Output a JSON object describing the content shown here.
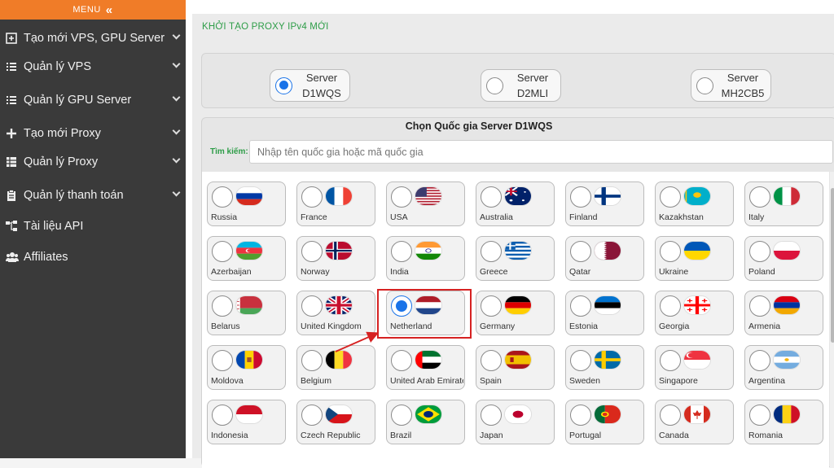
{
  "sidebar": {
    "menu_label": "MENU",
    "items": [
      {
        "label": "Tạo mới VPS, GPU Server",
        "icon": "plus-square-icon",
        "has_arrow": true
      },
      {
        "label": "Quản lý VPS",
        "icon": "list-icon",
        "has_arrow": true
      },
      {
        "label": "Quản lý GPU Server",
        "icon": "list-icon",
        "has_arrow": true
      },
      {
        "label": "Tạo mới Proxy",
        "icon": "plus-icon",
        "has_arrow": true
      },
      {
        "label": "Quản lý Proxy",
        "icon": "table-icon",
        "has_arrow": true
      },
      {
        "label": "Quản lý thanh toán",
        "icon": "clipboard-icon",
        "has_arrow": true
      },
      {
        "label": "Tài liệu API",
        "icon": "sitemap-icon",
        "has_arrow": false
      },
      {
        "label": "Affiliates",
        "icon": "users-icon",
        "has_arrow": false
      }
    ]
  },
  "page": {
    "title": "KHỞI TẠO PROXY IPv4 MỚI"
  },
  "servers": {
    "selected": "D1WQS",
    "options": [
      {
        "line1": "Server",
        "line2": "D1WQS",
        "selected": true
      },
      {
        "line1": "Server",
        "line2": "D2MLI",
        "selected": false
      },
      {
        "line1": "Server",
        "line2": "MH2CB5",
        "selected": false
      }
    ]
  },
  "country_panel": {
    "title": "Chọn Quốc gia Server D1WQS",
    "search_label": "Tìm kiếm:",
    "search_placeholder": "Nhập tên quốc gia hoặc mã quốc gia"
  },
  "countries": [
    {
      "name": "Russia",
      "flag": "russia-flag-icon",
      "selected": false
    },
    {
      "name": "France",
      "flag": "france-flag-icon",
      "selected": false
    },
    {
      "name": "USA",
      "flag": "usa-flag-icon",
      "selected": false
    },
    {
      "name": "Australia",
      "flag": "australia-flag-icon",
      "selected": false
    },
    {
      "name": "Finland",
      "flag": "finland-flag-icon",
      "selected": false
    },
    {
      "name": "Kazakhstan",
      "flag": "kazakhstan-flag-icon",
      "selected": false
    },
    {
      "name": "Italy",
      "flag": "italy-flag-icon",
      "selected": false
    },
    {
      "name": "Azerbaijan",
      "flag": "azerbaijan-flag-icon",
      "selected": false
    },
    {
      "name": "Norway",
      "flag": "norway-flag-icon",
      "selected": false
    },
    {
      "name": "India",
      "flag": "india-flag-icon",
      "selected": false
    },
    {
      "name": "Greece",
      "flag": "greece-flag-icon",
      "selected": false
    },
    {
      "name": "Qatar",
      "flag": "qatar-flag-icon",
      "selected": false
    },
    {
      "name": "Ukraine",
      "flag": "ukraine-flag-icon",
      "selected": false
    },
    {
      "name": "Poland",
      "flag": "poland-flag-icon",
      "selected": false
    },
    {
      "name": "Belarus",
      "flag": "belarus-flag-icon",
      "selected": false
    },
    {
      "name": "United Kingdom",
      "flag": "uk-flag-icon",
      "selected": false
    },
    {
      "name": "Netherland",
      "flag": "netherlands-flag-icon",
      "selected": true
    },
    {
      "name": "Germany",
      "flag": "germany-flag-icon",
      "selected": false
    },
    {
      "name": "Estonia",
      "flag": "estonia-flag-icon",
      "selected": false
    },
    {
      "name": "Georgia",
      "flag": "georgia-flag-icon",
      "selected": false
    },
    {
      "name": "Armenia",
      "flag": "armenia-flag-icon",
      "selected": false
    },
    {
      "name": "Moldova",
      "flag": "moldova-flag-icon",
      "selected": false
    },
    {
      "name": "Belgium",
      "flag": "belgium-flag-icon",
      "selected": false
    },
    {
      "name": "United Arab Emirates",
      "flag": "uae-flag-icon",
      "selected": false
    },
    {
      "name": "Spain",
      "flag": "spain-flag-icon",
      "selected": false
    },
    {
      "name": "Sweden",
      "flag": "sweden-flag-icon",
      "selected": false
    },
    {
      "name": "Singapore",
      "flag": "singapore-flag-icon",
      "selected": false
    },
    {
      "name": "Argentina",
      "flag": "argentina-flag-icon",
      "selected": false
    },
    {
      "name": "Indonesia",
      "flag": "indonesia-flag-icon",
      "selected": false
    },
    {
      "name": "Czech Republic",
      "flag": "czech-flag-icon",
      "selected": false
    },
    {
      "name": "Brazil",
      "flag": "brazil-flag-icon",
      "selected": false
    },
    {
      "name": "Japan",
      "flag": "japan-flag-icon",
      "selected": false
    },
    {
      "name": "Portugal",
      "flag": "portugal-flag-icon",
      "selected": false
    },
    {
      "name": "Canada",
      "flag": "canada-flag-icon",
      "selected": false
    },
    {
      "name": "Romania",
      "flag": "romania-flag-icon",
      "selected": false
    }
  ],
  "colors": {
    "accent": "#f07c28",
    "sidebar_bg": "#3a3a3a",
    "title_green": "#2e9d48",
    "radio_blue": "#1a73e8",
    "highlight_red": "#d62222"
  }
}
